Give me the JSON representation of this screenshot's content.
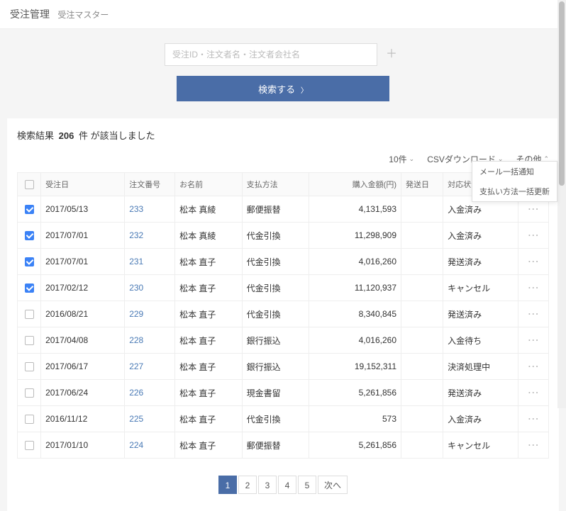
{
  "header": {
    "title": "受注管理",
    "subtitle": "受注マスター"
  },
  "search": {
    "placeholder": "受注ID・注文者名・注文者会社名",
    "button": "検索する"
  },
  "results": {
    "label": "検索結果",
    "count": "206",
    "suffix": "件 が該当しました"
  },
  "toolbar": {
    "perPage": "10件",
    "csv": "CSVダウンロード",
    "other": "その他"
  },
  "dropdown": {
    "item1": "メール一括通知",
    "item2": "支払い方法一括更新"
  },
  "columns": {
    "chk": "",
    "date": "受注日",
    "num": "注文番号",
    "name": "お名前",
    "pay": "支払方法",
    "amount": "購入金額(円)",
    "ship": "発送日",
    "status": "対応状況",
    "act": ""
  },
  "rows": [
    {
      "checked": true,
      "date": "2017/05/13",
      "num": "233",
      "name": "松本 真綾",
      "pay": "郵便振替",
      "amount": "4,131,593",
      "ship": "",
      "status": "入金済み"
    },
    {
      "checked": true,
      "date": "2017/07/01",
      "num": "232",
      "name": "松本 真綾",
      "pay": "代金引換",
      "amount": "11,298,909",
      "ship": "",
      "status": "入金済み"
    },
    {
      "checked": true,
      "date": "2017/07/01",
      "num": "231",
      "name": "松本 直子",
      "pay": "代金引換",
      "amount": "4,016,260",
      "ship": "",
      "status": "発送済み"
    },
    {
      "checked": true,
      "date": "2017/02/12",
      "num": "230",
      "name": "松本 直子",
      "pay": "代金引換",
      "amount": "11,120,937",
      "ship": "",
      "status": "キャンセル"
    },
    {
      "checked": false,
      "date": "2016/08/21",
      "num": "229",
      "name": "松本 直子",
      "pay": "代金引換",
      "amount": "8,340,845",
      "ship": "",
      "status": "発送済み"
    },
    {
      "checked": false,
      "date": "2017/04/08",
      "num": "228",
      "name": "松本 直子",
      "pay": "銀行振込",
      "amount": "4,016,260",
      "ship": "",
      "status": "入金待ち"
    },
    {
      "checked": false,
      "date": "2017/06/17",
      "num": "227",
      "name": "松本 直子",
      "pay": "銀行振込",
      "amount": "19,152,311",
      "ship": "",
      "status": "決済処理中"
    },
    {
      "checked": false,
      "date": "2017/06/24",
      "num": "226",
      "name": "松本 直子",
      "pay": "現金書留",
      "amount": "5,261,856",
      "ship": "",
      "status": "発送済み"
    },
    {
      "checked": false,
      "date": "2016/11/12",
      "num": "225",
      "name": "松本 直子",
      "pay": "代金引換",
      "amount": "573",
      "ship": "",
      "status": "入金済み"
    },
    {
      "checked": false,
      "date": "2017/01/10",
      "num": "224",
      "name": "松本 直子",
      "pay": "郵便振替",
      "amount": "5,261,856",
      "ship": "",
      "status": "キャンセル"
    }
  ],
  "pagination": {
    "pages": [
      "1",
      "2",
      "3",
      "4",
      "5"
    ],
    "active": 0,
    "next": "次へ"
  }
}
